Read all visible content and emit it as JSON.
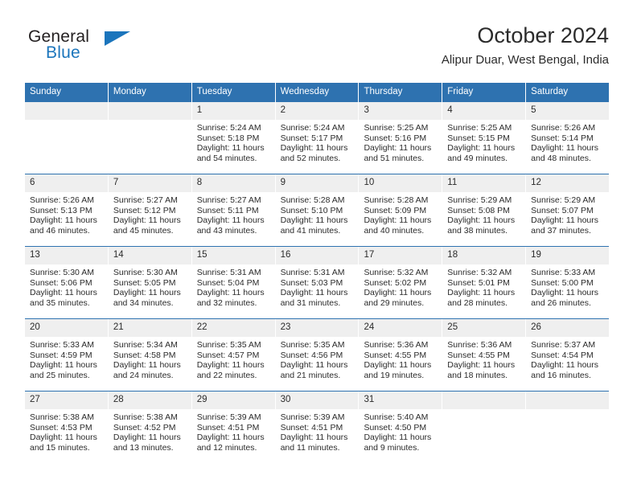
{
  "brand": {
    "line1": "General",
    "line2": "Blue",
    "accent_color": "#1b75bc"
  },
  "header": {
    "month_title": "October 2024",
    "location": "Alipur Duar, West Bengal, India"
  },
  "calendar": {
    "header_color": "#2e72b0",
    "weekdays": [
      "Sunday",
      "Monday",
      "Tuesday",
      "Wednesday",
      "Thursday",
      "Friday",
      "Saturday"
    ],
    "weeks": [
      [
        {
          "day": "",
          "sunrise": "",
          "sunset": "",
          "daylight": ""
        },
        {
          "day": "",
          "sunrise": "",
          "sunset": "",
          "daylight": ""
        },
        {
          "day": "1",
          "sunrise": "Sunrise: 5:24 AM",
          "sunset": "Sunset: 5:18 PM",
          "daylight": "Daylight: 11 hours and 54 minutes."
        },
        {
          "day": "2",
          "sunrise": "Sunrise: 5:24 AM",
          "sunset": "Sunset: 5:17 PM",
          "daylight": "Daylight: 11 hours and 52 minutes."
        },
        {
          "day": "3",
          "sunrise": "Sunrise: 5:25 AM",
          "sunset": "Sunset: 5:16 PM",
          "daylight": "Daylight: 11 hours and 51 minutes."
        },
        {
          "day": "4",
          "sunrise": "Sunrise: 5:25 AM",
          "sunset": "Sunset: 5:15 PM",
          "daylight": "Daylight: 11 hours and 49 minutes."
        },
        {
          "day": "5",
          "sunrise": "Sunrise: 5:26 AM",
          "sunset": "Sunset: 5:14 PM",
          "daylight": "Daylight: 11 hours and 48 minutes."
        }
      ],
      [
        {
          "day": "6",
          "sunrise": "Sunrise: 5:26 AM",
          "sunset": "Sunset: 5:13 PM",
          "daylight": "Daylight: 11 hours and 46 minutes."
        },
        {
          "day": "7",
          "sunrise": "Sunrise: 5:27 AM",
          "sunset": "Sunset: 5:12 PM",
          "daylight": "Daylight: 11 hours and 45 minutes."
        },
        {
          "day": "8",
          "sunrise": "Sunrise: 5:27 AM",
          "sunset": "Sunset: 5:11 PM",
          "daylight": "Daylight: 11 hours and 43 minutes."
        },
        {
          "day": "9",
          "sunrise": "Sunrise: 5:28 AM",
          "sunset": "Sunset: 5:10 PM",
          "daylight": "Daylight: 11 hours and 41 minutes."
        },
        {
          "day": "10",
          "sunrise": "Sunrise: 5:28 AM",
          "sunset": "Sunset: 5:09 PM",
          "daylight": "Daylight: 11 hours and 40 minutes."
        },
        {
          "day": "11",
          "sunrise": "Sunrise: 5:29 AM",
          "sunset": "Sunset: 5:08 PM",
          "daylight": "Daylight: 11 hours and 38 minutes."
        },
        {
          "day": "12",
          "sunrise": "Sunrise: 5:29 AM",
          "sunset": "Sunset: 5:07 PM",
          "daylight": "Daylight: 11 hours and 37 minutes."
        }
      ],
      [
        {
          "day": "13",
          "sunrise": "Sunrise: 5:30 AM",
          "sunset": "Sunset: 5:06 PM",
          "daylight": "Daylight: 11 hours and 35 minutes."
        },
        {
          "day": "14",
          "sunrise": "Sunrise: 5:30 AM",
          "sunset": "Sunset: 5:05 PM",
          "daylight": "Daylight: 11 hours and 34 minutes."
        },
        {
          "day": "15",
          "sunrise": "Sunrise: 5:31 AM",
          "sunset": "Sunset: 5:04 PM",
          "daylight": "Daylight: 11 hours and 32 minutes."
        },
        {
          "day": "16",
          "sunrise": "Sunrise: 5:31 AM",
          "sunset": "Sunset: 5:03 PM",
          "daylight": "Daylight: 11 hours and 31 minutes."
        },
        {
          "day": "17",
          "sunrise": "Sunrise: 5:32 AM",
          "sunset": "Sunset: 5:02 PM",
          "daylight": "Daylight: 11 hours and 29 minutes."
        },
        {
          "day": "18",
          "sunrise": "Sunrise: 5:32 AM",
          "sunset": "Sunset: 5:01 PM",
          "daylight": "Daylight: 11 hours and 28 minutes."
        },
        {
          "day": "19",
          "sunrise": "Sunrise: 5:33 AM",
          "sunset": "Sunset: 5:00 PM",
          "daylight": "Daylight: 11 hours and 26 minutes."
        }
      ],
      [
        {
          "day": "20",
          "sunrise": "Sunrise: 5:33 AM",
          "sunset": "Sunset: 4:59 PM",
          "daylight": "Daylight: 11 hours and 25 minutes."
        },
        {
          "day": "21",
          "sunrise": "Sunrise: 5:34 AM",
          "sunset": "Sunset: 4:58 PM",
          "daylight": "Daylight: 11 hours and 24 minutes."
        },
        {
          "day": "22",
          "sunrise": "Sunrise: 5:35 AM",
          "sunset": "Sunset: 4:57 PM",
          "daylight": "Daylight: 11 hours and 22 minutes."
        },
        {
          "day": "23",
          "sunrise": "Sunrise: 5:35 AM",
          "sunset": "Sunset: 4:56 PM",
          "daylight": "Daylight: 11 hours and 21 minutes."
        },
        {
          "day": "24",
          "sunrise": "Sunrise: 5:36 AM",
          "sunset": "Sunset: 4:55 PM",
          "daylight": "Daylight: 11 hours and 19 minutes."
        },
        {
          "day": "25",
          "sunrise": "Sunrise: 5:36 AM",
          "sunset": "Sunset: 4:55 PM",
          "daylight": "Daylight: 11 hours and 18 minutes."
        },
        {
          "day": "26",
          "sunrise": "Sunrise: 5:37 AM",
          "sunset": "Sunset: 4:54 PM",
          "daylight": "Daylight: 11 hours and 16 minutes."
        }
      ],
      [
        {
          "day": "27",
          "sunrise": "Sunrise: 5:38 AM",
          "sunset": "Sunset: 4:53 PM",
          "daylight": "Daylight: 11 hours and 15 minutes."
        },
        {
          "day": "28",
          "sunrise": "Sunrise: 5:38 AM",
          "sunset": "Sunset: 4:52 PM",
          "daylight": "Daylight: 11 hours and 13 minutes."
        },
        {
          "day": "29",
          "sunrise": "Sunrise: 5:39 AM",
          "sunset": "Sunset: 4:51 PM",
          "daylight": "Daylight: 11 hours and 12 minutes."
        },
        {
          "day": "30",
          "sunrise": "Sunrise: 5:39 AM",
          "sunset": "Sunset: 4:51 PM",
          "daylight": "Daylight: 11 hours and 11 minutes."
        },
        {
          "day": "31",
          "sunrise": "Sunrise: 5:40 AM",
          "sunset": "Sunset: 4:50 PM",
          "daylight": "Daylight: 11 hours and 9 minutes."
        },
        {
          "day": "",
          "sunrise": "",
          "sunset": "",
          "daylight": ""
        },
        {
          "day": "",
          "sunrise": "",
          "sunset": "",
          "daylight": ""
        }
      ]
    ]
  }
}
